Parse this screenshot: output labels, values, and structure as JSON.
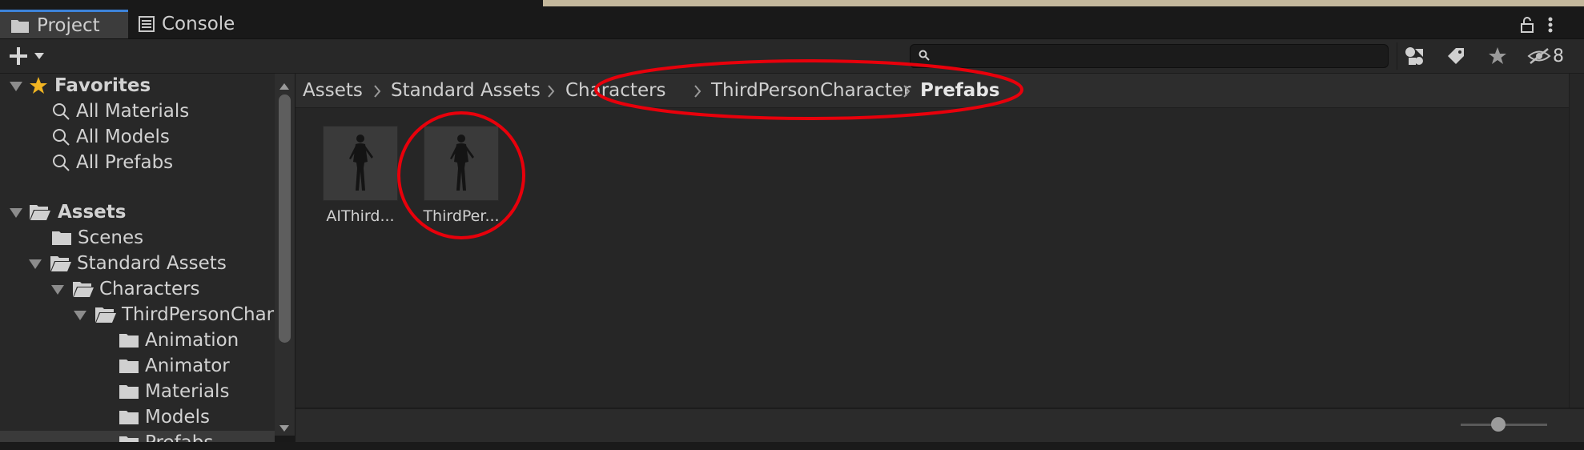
{
  "tabs": [
    {
      "label": "Project",
      "icon": "folder-icon",
      "active": true
    },
    {
      "label": "Console",
      "icon": "console-icon",
      "active": false
    }
  ],
  "toolbar": {
    "add_icon": "plus-icon",
    "search_value": "",
    "hidden_count": "8"
  },
  "tree": {
    "favorites": {
      "label": "Favorites",
      "items": [
        "All Materials",
        "All Models",
        "All Prefabs"
      ]
    },
    "assets": {
      "label": "Assets",
      "items": [
        {
          "label": "Scenes"
        },
        {
          "label": "Standard Assets"
        },
        {
          "label": "Characters"
        },
        {
          "label": "ThirdPersonChar"
        },
        {
          "label": "Animation"
        },
        {
          "label": "Animator"
        },
        {
          "label": "Materials"
        },
        {
          "label": "Models"
        },
        {
          "label": "Prefabs"
        }
      ]
    }
  },
  "breadcrumb": [
    "Assets",
    "Standard Assets",
    "Characters",
    "ThirdPersonCharacter",
    "Prefabs"
  ],
  "assets": [
    {
      "label": "AIThird..."
    },
    {
      "label": "ThirdPer..."
    }
  ],
  "annotation_color": "#e8000b",
  "accent_color": "#3d83d9"
}
